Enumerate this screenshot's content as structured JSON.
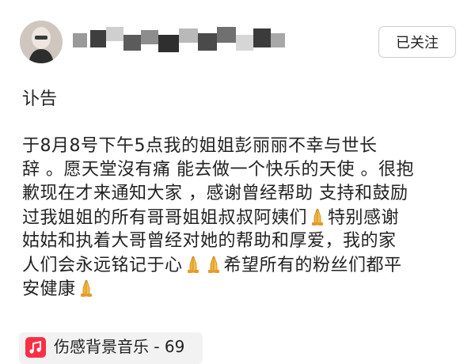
{
  "post": {
    "follow_label": "已关注",
    "title": "讣告",
    "body_lines": [
      "于8月8号下午5点我的姐姐彭丽丽不幸与世长",
      "辞 。愿天堂沒有痛 能去做一个快乐的天使 。很抱",
      "歉现在才来通知大家 ，感谢曾经帮助 支持和鼓励",
      "过我姐姐的所有哥哥姐姐叔叔阿姨们",
      "特别感谢",
      "姑姑和执着大哥曾经对她的帮助和厚爱，我的家",
      "人们会永远铭记于心",
      "希望所有的粉丝们都平",
      "安健康"
    ]
  },
  "music": {
    "title": "伤感背景音乐 - 69"
  },
  "icons": {
    "avatar": "avatar-photo",
    "username": "mosaic-blurred-username",
    "pray": "folded-hands-icon",
    "music": "music-note-icon"
  },
  "colors": {
    "pray_emoji": "#F2B33D",
    "music_app": "#FA2F45",
    "follow_border": "#CFCFCF"
  }
}
